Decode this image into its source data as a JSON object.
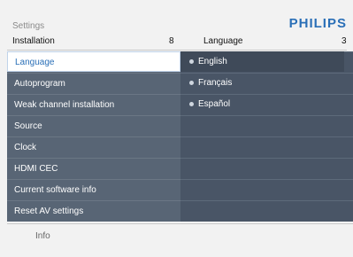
{
  "top": {
    "title": "Settings",
    "brand": "PHILIPS"
  },
  "header": {
    "left_label": "Installation",
    "left_count": "8",
    "right_label": "Language",
    "right_count": "3"
  },
  "menu": {
    "items": [
      {
        "label": "Language",
        "selected": true
      },
      {
        "label": "Autoprogram"
      },
      {
        "label": "Weak channel installation"
      },
      {
        "label": "Source"
      },
      {
        "label": "Clock"
      },
      {
        "label": "HDMI CEC"
      },
      {
        "label": "Current software info"
      },
      {
        "label": "Reset AV settings"
      }
    ]
  },
  "options": {
    "items": [
      {
        "label": "English",
        "active": true
      },
      {
        "label": "Français"
      },
      {
        "label": "Español"
      }
    ]
  },
  "footer": {
    "info": "Info"
  },
  "colors": {
    "brand": "#2a6fb7",
    "menu_bg": "#586575",
    "panel_bg": "#495566"
  }
}
